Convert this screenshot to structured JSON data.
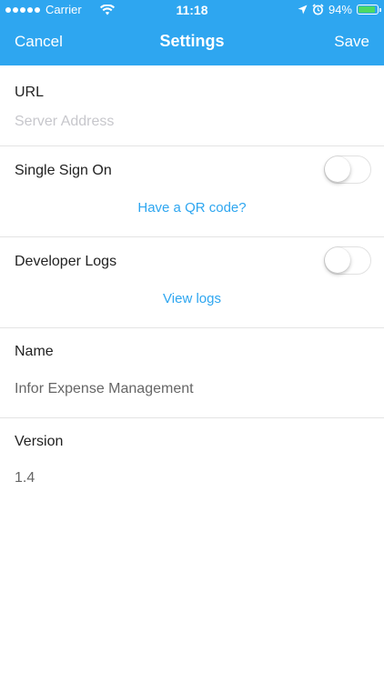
{
  "status_bar": {
    "carrier": "Carrier",
    "time": "11:18",
    "battery_percent": "94%",
    "battery_level": 0.94,
    "signal_icon": "signal-dots-icon",
    "wifi_icon": "wifi-icon",
    "location_icon": "location-arrow-icon",
    "alarm_icon": "alarm-clock-icon"
  },
  "navbar": {
    "cancel_label": "Cancel",
    "title": "Settings",
    "save_label": "Save"
  },
  "url_section": {
    "label": "URL",
    "value": "",
    "placeholder": "Server Address"
  },
  "sso_section": {
    "label": "Single Sign On",
    "toggle_on": false,
    "link_label": "Have a QR code?"
  },
  "dev_logs_section": {
    "label": "Developer Logs",
    "toggle_on": false,
    "link_label": "View logs"
  },
  "name_section": {
    "label": "Name",
    "value": "Infor Expense Management"
  },
  "version_section": {
    "label": "Version",
    "value": "1.4"
  },
  "colors": {
    "accent": "#2ea6f0",
    "battery_fill": "#4cd964",
    "divider": "#e4e4e4"
  }
}
